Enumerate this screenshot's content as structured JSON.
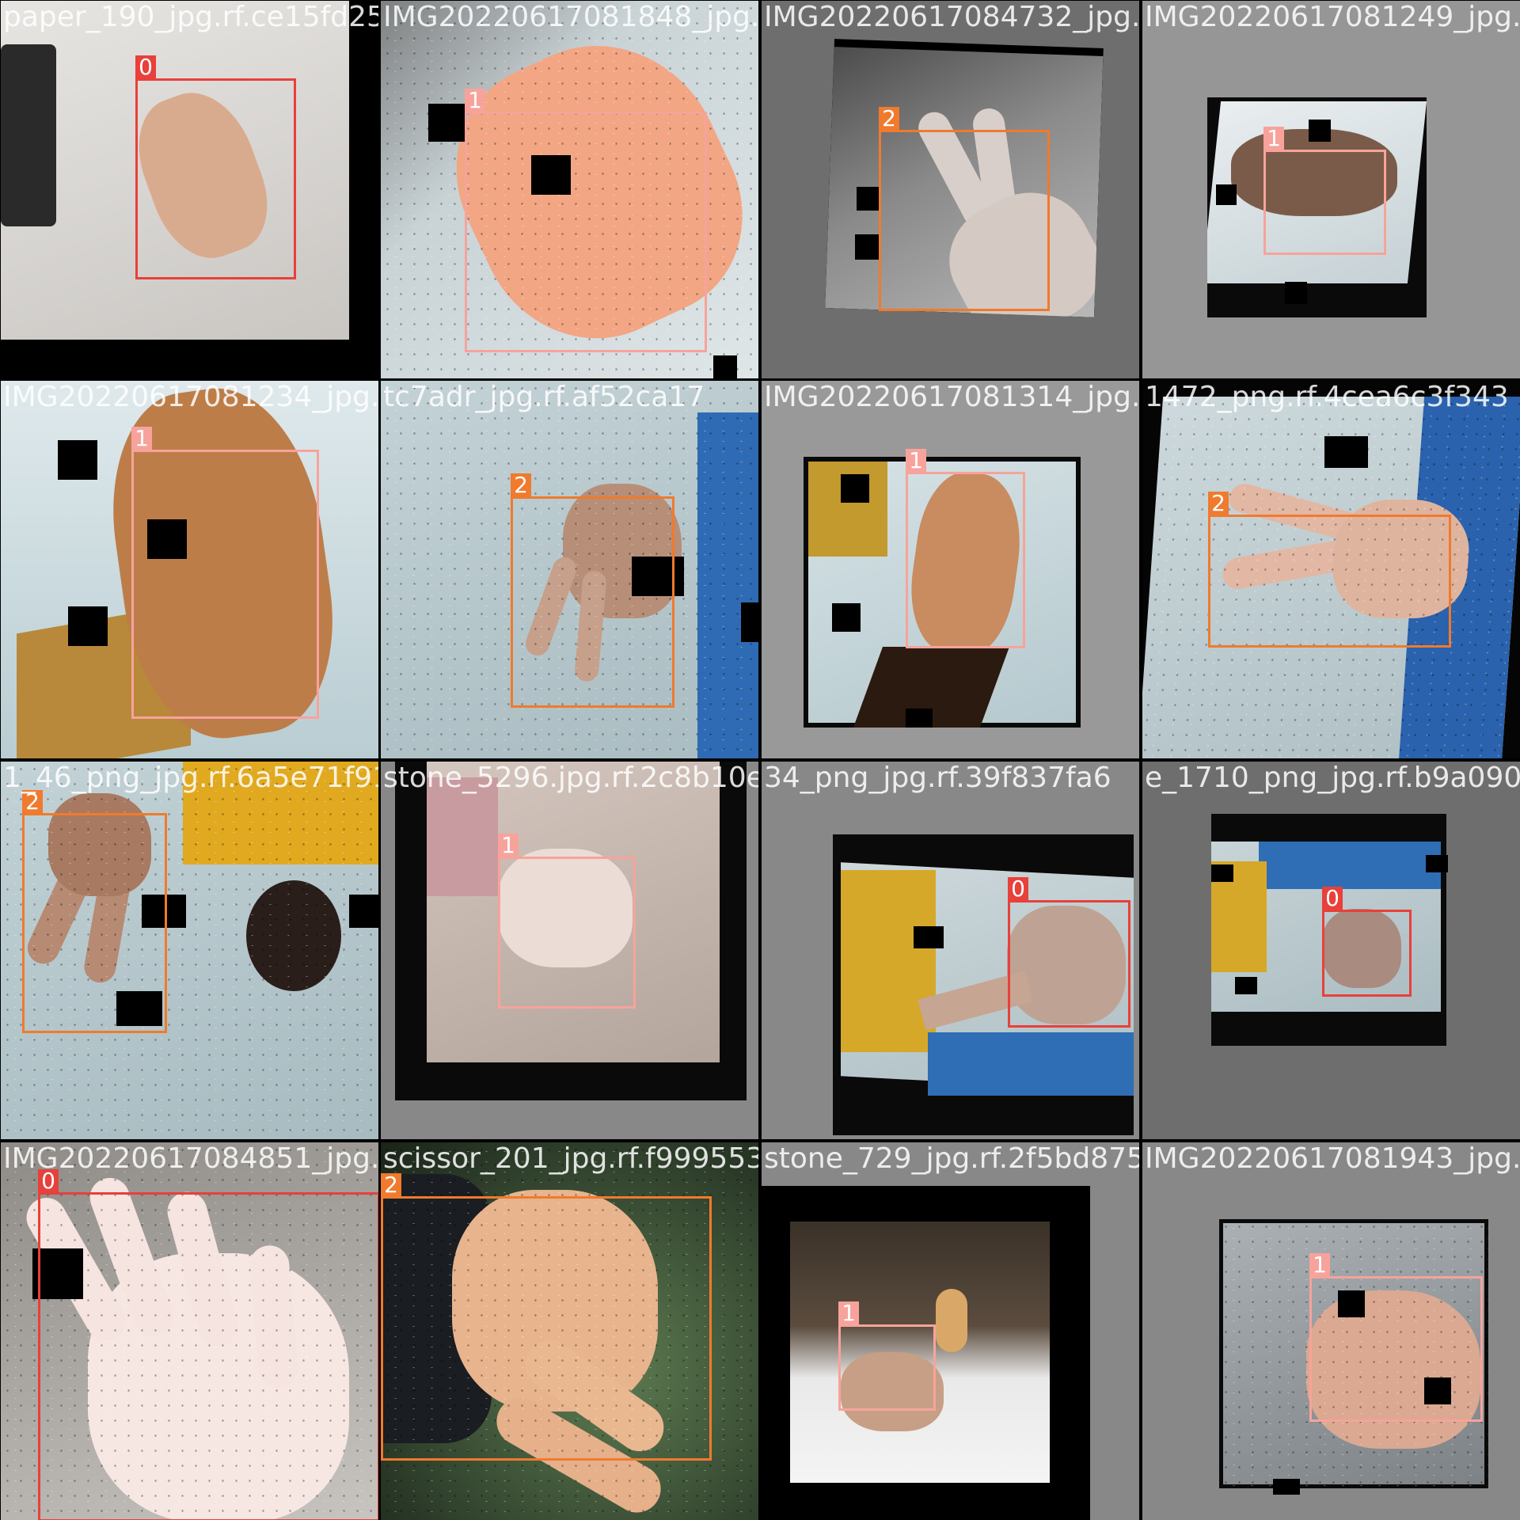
{
  "colors": {
    "class_0": "#e8403a",
    "class_1": "#f7a39b",
    "class_2": "#f07a2d"
  },
  "tiles": [
    {
      "filename": "paper_190_jpg.rf.ce15fd253a4",
      "boxes": [
        {
          "label": "0"
        }
      ]
    },
    {
      "filename": "IMG20220617081848_jpg.rf.",
      "boxes": [
        {
          "label": "1"
        }
      ]
    },
    {
      "filename": "IMG20220617084732_jpg.rf.",
      "boxes": [
        {
          "label": "2"
        }
      ]
    },
    {
      "filename": "IMG20220617081249_jpg.rf.",
      "boxes": [
        {
          "label": "1"
        }
      ]
    },
    {
      "filename": "IMG20220617081234_jpg.rf.",
      "boxes": [
        {
          "label": "1"
        }
      ]
    },
    {
      "filename": "tc7adr_jpg.rf.af52ca17",
      "boxes": [
        {
          "label": "2"
        }
      ]
    },
    {
      "filename": "IMG20220617081314_jpg.rf.",
      "boxes": [
        {
          "label": "1"
        }
      ]
    },
    {
      "filename": "1472_png.rf.4cea6c3f343",
      "boxes": [
        {
          "label": "2"
        }
      ]
    },
    {
      "filename": "1_46_png_jpg.rf.6a5e71f91f",
      "boxes": [
        {
          "label": "2"
        }
      ]
    },
    {
      "filename": "stone_5296.jpg.rf.2c8b10e3c",
      "boxes": [
        {
          "label": "1"
        }
      ]
    },
    {
      "filename": "34_png_jpg.rf.39f837fa6",
      "boxes": [
        {
          "label": "0"
        }
      ]
    },
    {
      "filename": "e_1710_png_jpg.rf.b9a09092",
      "boxes": [
        {
          "label": "0"
        }
      ]
    },
    {
      "filename": "IMG20220617084851_jpg.rf.",
      "boxes": [
        {
          "label": "0"
        }
      ]
    },
    {
      "filename": "scissor_201_jpg.rf.f999553",
      "boxes": [
        {
          "label": "2"
        }
      ]
    },
    {
      "filename": "stone_729_jpg.rf.2f5bd8752",
      "boxes": [
        {
          "label": "1"
        }
      ]
    },
    {
      "filename": "IMG20220617081943_jpg.rf.",
      "boxes": [
        {
          "label": "1"
        }
      ]
    }
  ]
}
